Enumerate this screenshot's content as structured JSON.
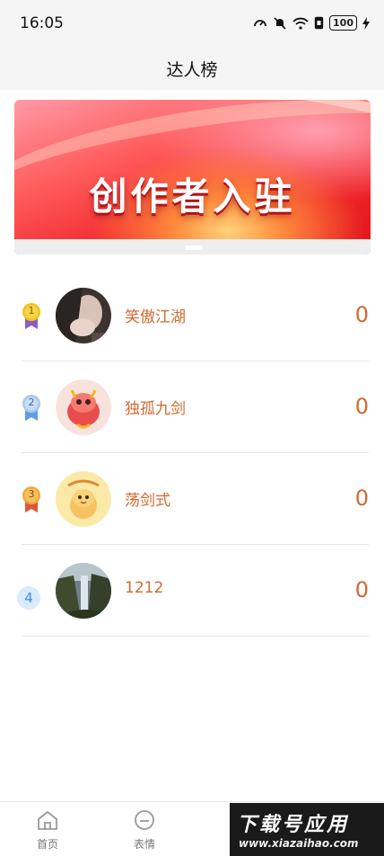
{
  "status_bar": {
    "time": "16:05",
    "battery": "100"
  },
  "nav": {
    "title": "达人榜"
  },
  "banner": {
    "text": "创作者入驻"
  },
  "rankings": [
    {
      "rank": "1",
      "name": "笑傲江湖",
      "score": "0",
      "medal_color": "#f2c21b",
      "ribbon_color": "#8a5cc9"
    },
    {
      "rank": "2",
      "name": "独孤九剑",
      "score": "0",
      "medal_color": "#a9c9ec",
      "ribbon_color": "#5e9ee0"
    },
    {
      "rank": "3",
      "name": "荡剑式",
      "score": "0",
      "medal_color": "#f0a93a",
      "ribbon_color": "#e2553a"
    },
    {
      "rank": "4",
      "name": "1212",
      "score": "0"
    }
  ],
  "tabs": [
    {
      "label": "首页",
      "icon": "home-icon"
    },
    {
      "label": "表情",
      "icon": "emoji-icon"
    }
  ],
  "watermark": {
    "main": "下载号应用",
    "sub": "www.xiazaihao.com"
  },
  "colors": {
    "accent": "#d2692f",
    "banner_red": "#f2282c"
  }
}
